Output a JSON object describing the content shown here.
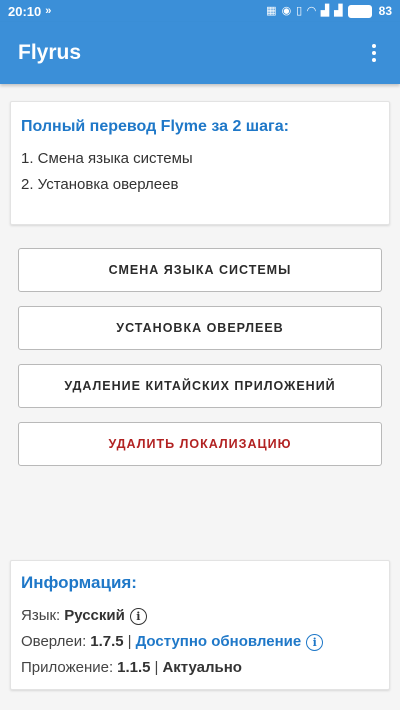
{
  "status_bar": {
    "time": "20:10",
    "forward_glyph": "»",
    "battery": "83"
  },
  "app": {
    "title": "Flyrus"
  },
  "guide": {
    "title": "Полный перевод Flyme за 2 шага:",
    "steps": [
      "1. Смена языка системы",
      "2. Установка оверлеев"
    ]
  },
  "actions": {
    "change_language": "СМЕНА ЯЗЫКА СИСТЕМЫ",
    "install_overlays": "УСТАНОВКА ОВЕРЛЕЕВ",
    "remove_chinese_apps": "УДАЛЕНИЕ КИТАЙСКИХ ПРИЛОЖЕНИЙ",
    "remove_localization": "УДАЛИТЬ ЛОКАЛИЗАЦИЮ"
  },
  "info": {
    "title": "Информация:",
    "language_label": "Язык:",
    "language_value": "Русский",
    "overlays_label": "Оверлеи:",
    "overlays_value": "1.7.5",
    "separator": "|",
    "overlays_update": "Доступно обновление",
    "app_label": "Приложение:",
    "app_value": "1.1.5",
    "app_status": "Актуально"
  },
  "colors": {
    "primary": "#3b8fd8",
    "accent_text": "#1f78c8",
    "danger": "#b22222"
  },
  "icons": [
    "menu-more-icon",
    "info-icon"
  ]
}
